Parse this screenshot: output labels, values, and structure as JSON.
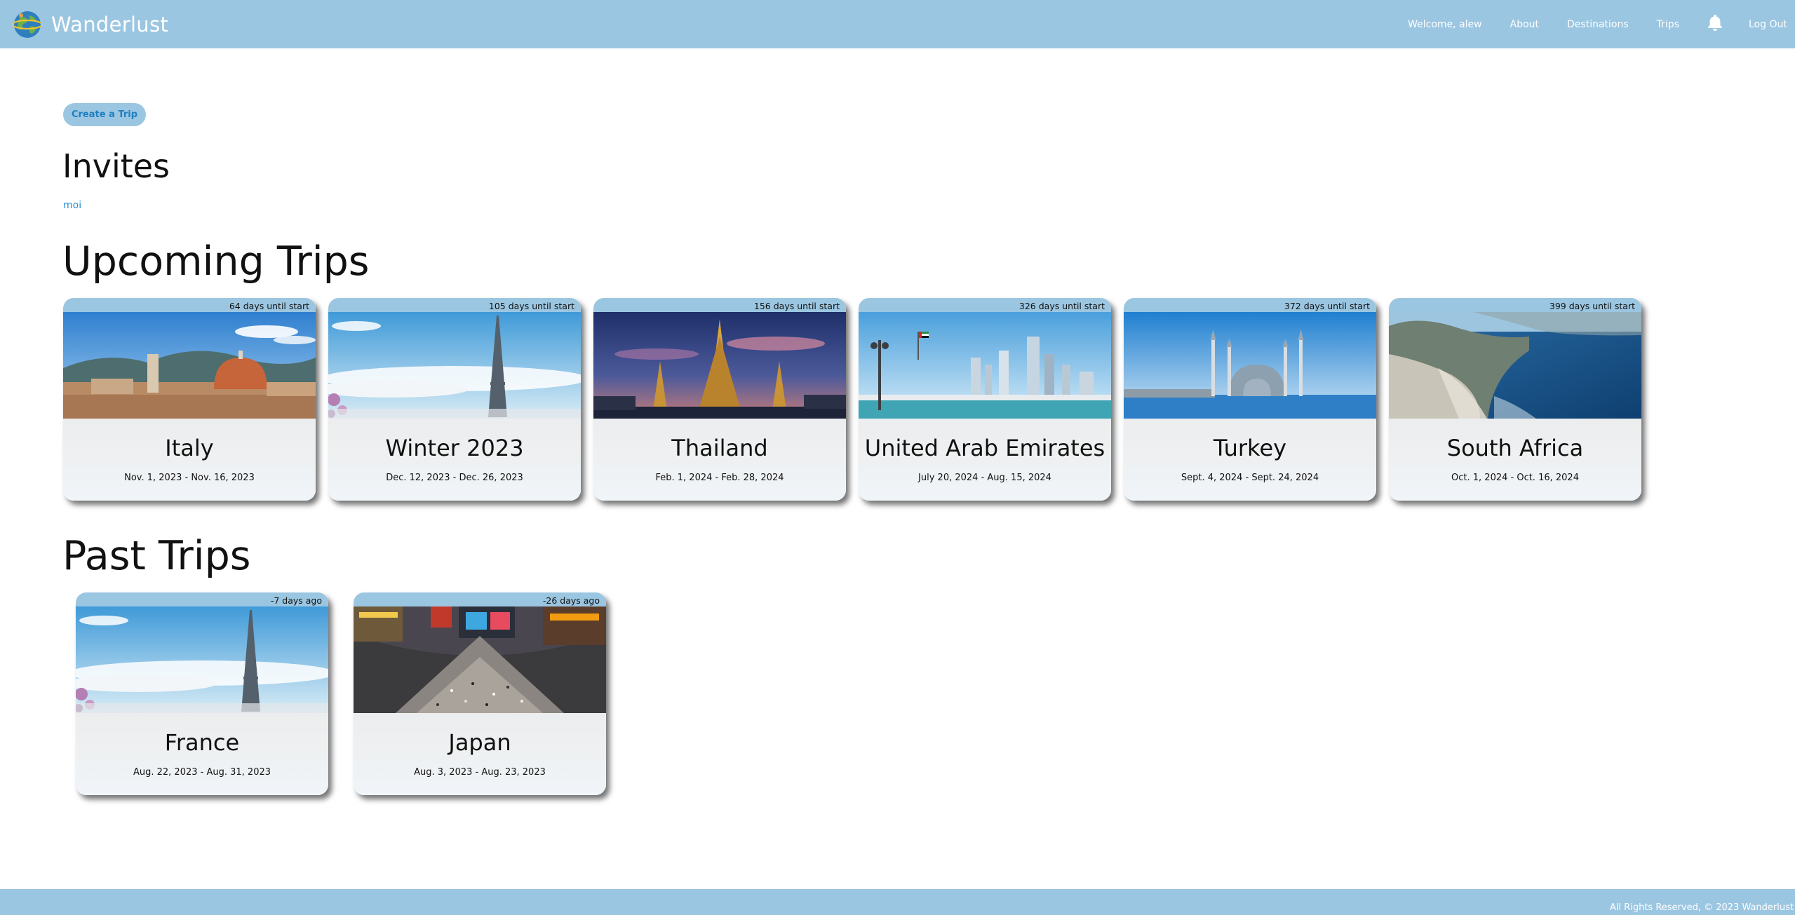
{
  "navbar": {
    "brand": "Wanderlust",
    "logo_icon": "globe-logo-icon",
    "links": {
      "welcome": "Welcome, alew",
      "about": "About",
      "destinations": "Destinations",
      "trips": "Trips",
      "logout": "Log Out"
    },
    "notification_icon": "bell-icon"
  },
  "main": {
    "create_trip": "Create a Trip",
    "invites": {
      "title": "Invites",
      "items": [
        "moi"
      ]
    },
    "upcoming": {
      "title": "Upcoming Trips",
      "trips": [
        {
          "name": "Italy",
          "dates": "Nov. 1, 2023 - Nov. 16, 2023",
          "countdown": "64 days until start"
        },
        {
          "name": "Winter 2023",
          "dates": "Dec. 12, 2023 - Dec. 26, 2023",
          "countdown": "105 days until start"
        },
        {
          "name": "Thailand",
          "dates": "Feb. 1, 2024 - Feb. 28, 2024",
          "countdown": "156 days until start"
        },
        {
          "name": "United Arab Emirates",
          "dates": "July 20, 2024 - Aug. 15, 2024",
          "countdown": "326 days until start"
        },
        {
          "name": "Turkey",
          "dates": "Sept. 4, 2024 - Sept. 24, 2024",
          "countdown": "372 days until start"
        },
        {
          "name": "South Africa",
          "dates": "Oct. 1, 2024 - Oct. 16, 2024",
          "countdown": "399 days until start"
        }
      ]
    },
    "past": {
      "title": "Past Trips",
      "trips": [
        {
          "name": "France",
          "dates": "Aug. 22, 2023 - Aug. 31, 2023",
          "countdown": "-7 days ago"
        },
        {
          "name": "Japan",
          "dates": "Aug. 3, 2023 - Aug. 23, 2023",
          "countdown": "-26 days ago"
        }
      ]
    }
  },
  "footer": {
    "copyright": "All Rights Reserved, © 2023 Wanderlust"
  },
  "colors": {
    "brand": "#9bc6e1",
    "link": "#2a8fd0",
    "button_text": "#1f7fc0"
  }
}
